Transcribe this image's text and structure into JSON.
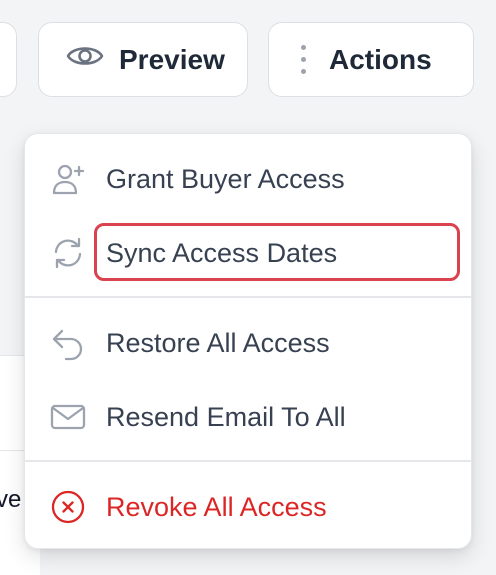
{
  "toolbar": {
    "preview_label": "Preview",
    "actions_label": "Actions"
  },
  "background": {
    "partial_text": "ve"
  },
  "menu": {
    "items": [
      {
        "label": "Grant Buyer Access",
        "icon": "user-plus-icon"
      },
      {
        "label": "Sync Access Dates",
        "icon": "sync-icon",
        "highlighted": true
      },
      {
        "label": "Restore All Access",
        "icon": "undo-arrow-icon"
      },
      {
        "label": "Resend Email To All",
        "icon": "mail-icon"
      },
      {
        "label": "Revoke All Access",
        "icon": "x-circle-icon",
        "danger": true
      }
    ]
  },
  "colors": {
    "danger": "#dc2626",
    "highlight": "#d9424e",
    "icon_gray": "#9ca3af",
    "text": "#374151"
  }
}
